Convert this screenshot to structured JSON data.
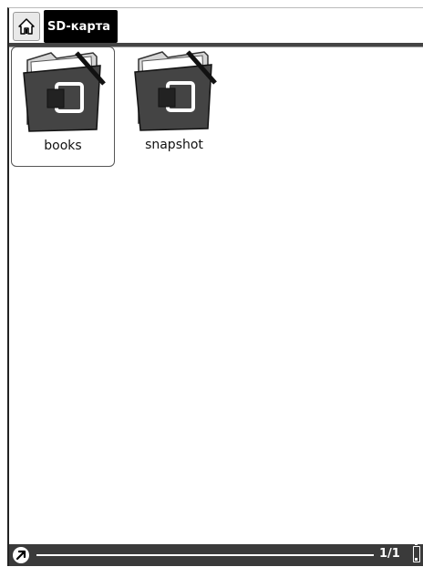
{
  "header": {
    "home_icon": "home-icon",
    "location_tab": "SD-карта"
  },
  "files": [
    {
      "name": "books",
      "icon": "folder-icon",
      "selected": true
    },
    {
      "name": "snapshot",
      "icon": "folder-icon",
      "selected": false
    }
  ],
  "status": {
    "menu_icon": "arrow-up-right-icon",
    "page": "1/1",
    "battery_icon": "battery-icon",
    "battery_level": 0.2
  },
  "colors": {
    "tab_bg": "#000000",
    "statusbar_bg": "#3a3a3a"
  }
}
